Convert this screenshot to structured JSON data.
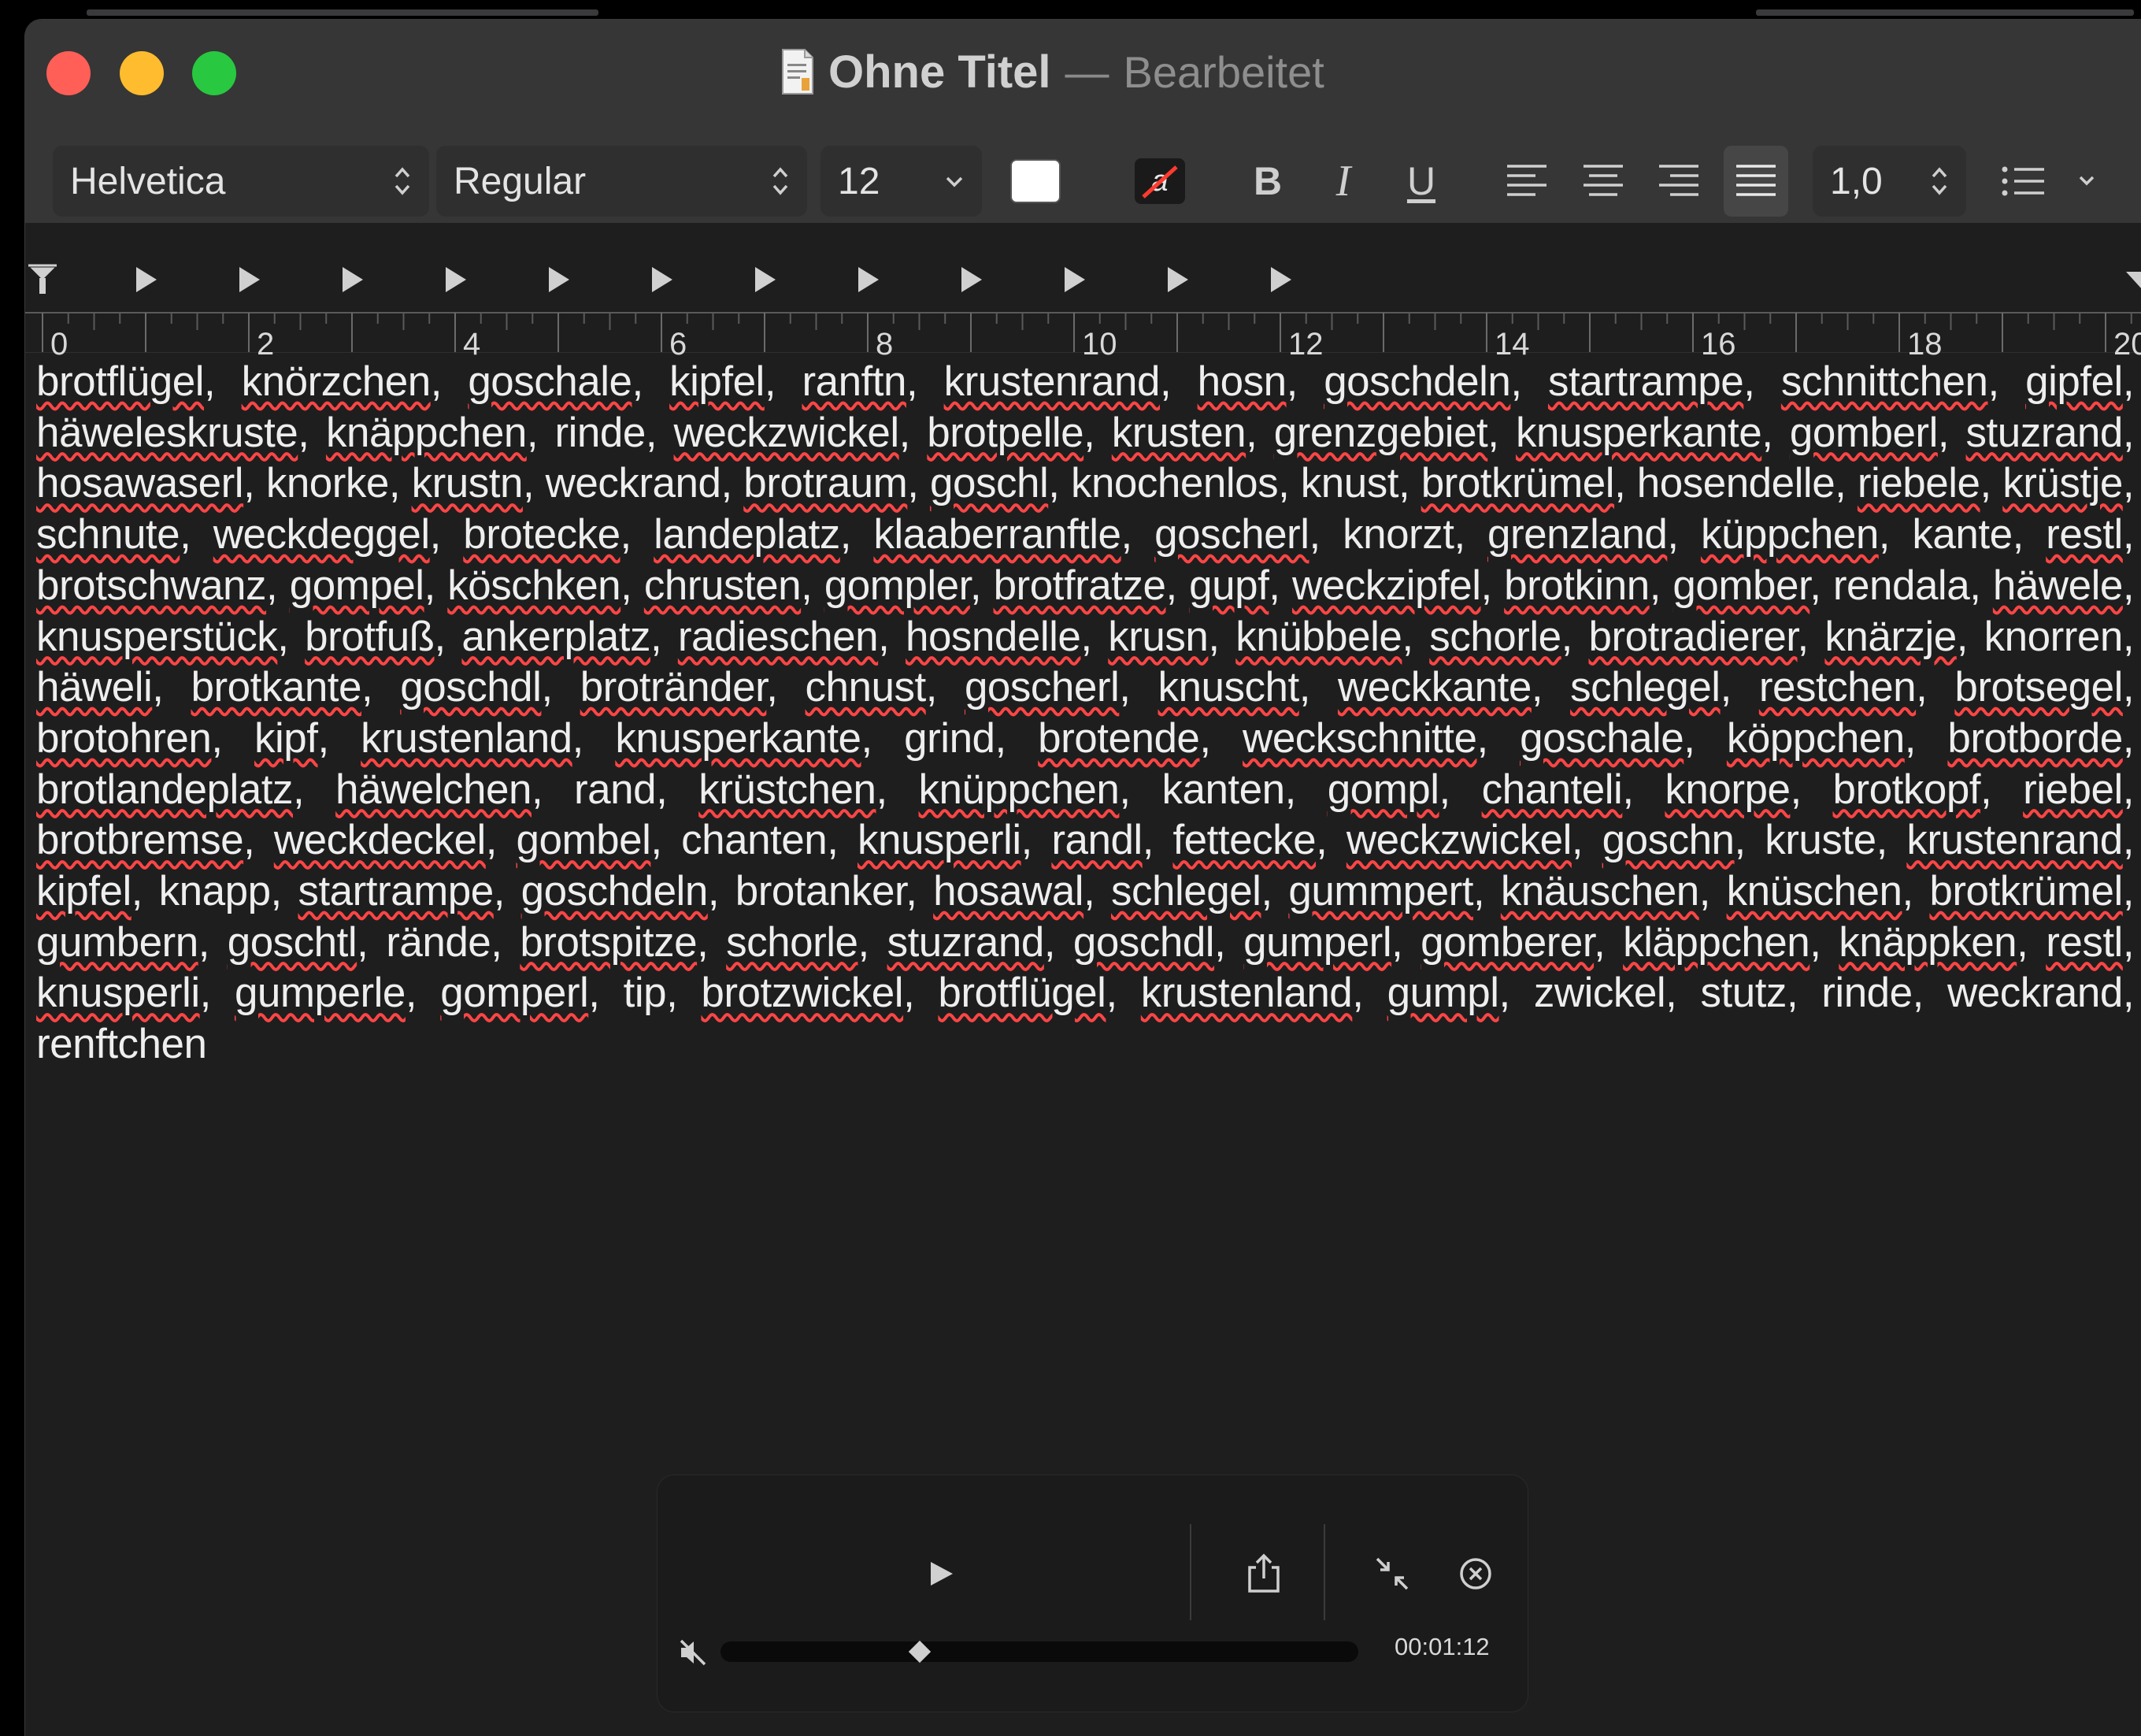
{
  "window": {
    "title": "Ohne Titel",
    "separator": "—",
    "status": "Bearbeitet",
    "icon": "text-document-icon"
  },
  "toolbar": {
    "font_family": "Helvetica",
    "font_style": "Regular",
    "font_size": "12",
    "text_color": "#ffffff",
    "bold_label": "B",
    "italic_label": "I",
    "underline_label": "U",
    "line_spacing": "1,0",
    "alignment_selected": "justify"
  },
  "ruler": {
    "labels": [
      "0",
      "2",
      "4",
      "6",
      "8",
      "10",
      "12",
      "14",
      "16",
      "18",
      "20"
    ]
  },
  "document": {
    "words": [
      "brotflügel",
      "knörzchen",
      "goschale",
      "kipfel",
      "ranftn",
      "krustenrand",
      "hosn",
      "goschdeln",
      "startrampe",
      "schnittchen",
      "gipfel",
      "häweleskruste",
      "knäppchen",
      "rinde",
      "weckzwickel",
      "brotpelle",
      "krusten",
      "grenzgebiet",
      "knusperkante",
      "gomberl",
      "stuzrand",
      "hosawaserl",
      "knorke",
      "krustn",
      "weckrand",
      "brotraum",
      "goschl",
      "knochenlos",
      "knust",
      "brotkrümel",
      "hosendelle",
      "riebele",
      "krüstje",
      "schnute",
      "weckdeggel",
      "brotecke",
      "landeplatz",
      "klaaberranftle",
      "goscherl",
      "knorzt",
      "grenzland",
      "küppchen",
      "kante",
      "restl",
      "brotschwanz",
      "gompel",
      "köschken",
      "chrusten",
      "gompler",
      "brotfratze",
      "gupf",
      "weckzipfel",
      "brotkinn",
      "gomber",
      "rendala",
      "häwele",
      "knusperstück",
      "brotfuß",
      "ankerplatz",
      "radieschen",
      "hosndelle",
      "krusn",
      "knübbele",
      "schorle",
      "brotradierer",
      "knärzje",
      "knorren",
      "häweli",
      "brotkante",
      "goschdl",
      "brotränder",
      "chnust",
      "goscherl",
      "knuscht",
      "weckkante",
      "schlegel",
      "restchen",
      "brotsegel",
      "brotohren",
      "kipf",
      "krustenland",
      "knusperkante",
      "grind",
      "brotende",
      "weckschnitte",
      "goschale",
      "köppchen",
      "brotborde",
      "brotlandeplatz",
      "häwelchen",
      "rand",
      "krüstchen",
      "knüppchen",
      "kanten",
      "gompl",
      "chanteli",
      "knorpe",
      "brotkopf",
      "riebel",
      "brotbremse",
      "weckdeckel",
      "gombel",
      "chanten",
      "knusperli",
      "randl",
      "fettecke",
      "weckzwickel",
      "goschn",
      "kruste",
      "krustenrand",
      "kipfel",
      "knapp",
      "startrampe",
      "goschdeln",
      "brotanker",
      "hosawal",
      "schlegel",
      "gummpert",
      "knäuschen",
      "knüschen",
      "brotkrümel",
      "gumbern",
      "goschtl",
      " rände",
      "brotspitze",
      "schorle",
      "stuzrand",
      "goschdl",
      "gumperl",
      "gomberer",
      "kläppchen",
      "knäppken",
      "restl",
      "knusperli",
      "gumperle",
      "gomperl",
      "tip",
      "brotzwickel",
      "brotflügel",
      "krustenland",
      "gumpl",
      "zwickel",
      "stutz",
      "rinde",
      "weckrand",
      "renftchen"
    ],
    "unmarked": [
      "knorke",
      "weckrand",
      "knochenlos",
      "knust",
      "hosendelle",
      "knorzt",
      "kante",
      "rendala",
      "knorren",
      "grind",
      "rand",
      "kanten",
      "chanten",
      "kruste",
      "knapp",
      "brotanker",
      "rände",
      "tip",
      "zwickel",
      "stutz",
      "rinde",
      "renftchen"
    ]
  },
  "player": {
    "time": "00:01:12",
    "progress": 0.3
  },
  "colors": {
    "window_bg": "#1e1e1e",
    "titlebar_bg": "#363636",
    "spell_underline": "#ff4545",
    "close": "#ff5f57",
    "minimize": "#febc2e",
    "maximize": "#28c840"
  }
}
